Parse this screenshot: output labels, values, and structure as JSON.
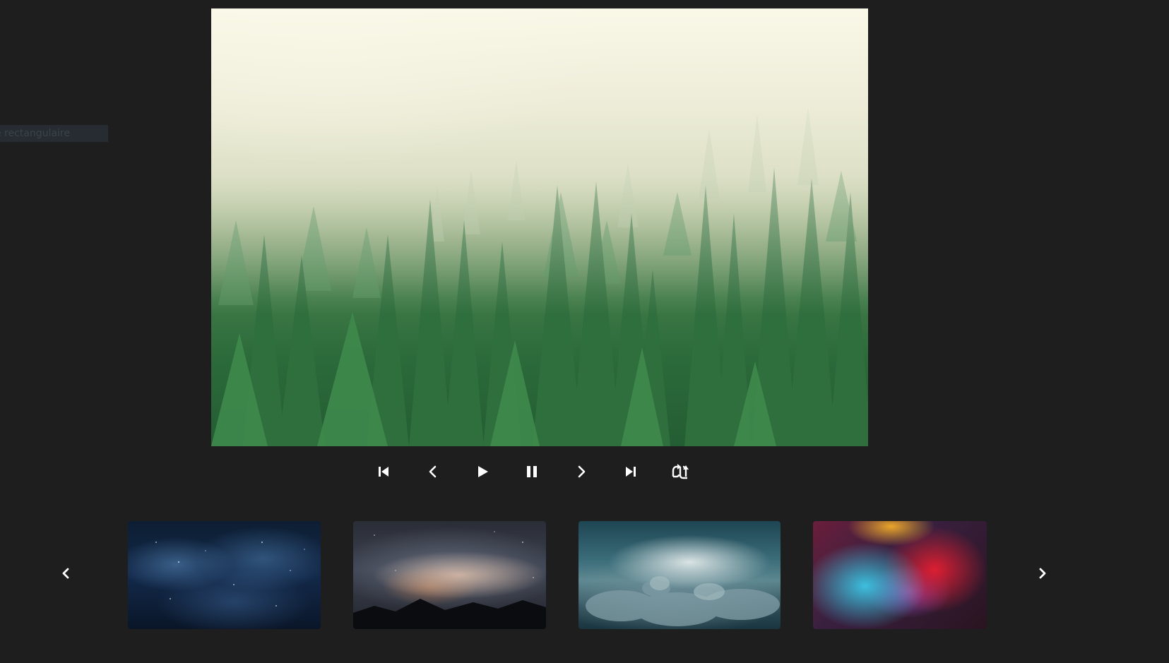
{
  "side_label": {
    "text": "e rectangulaire"
  },
  "viewer": {
    "main_image": {
      "subject": "misty-pine-forest"
    }
  },
  "controls": {
    "icons": [
      "first-icon",
      "previous-icon",
      "play-icon",
      "pause-icon",
      "next-icon",
      "last-icon",
      "shuffle-icon"
    ],
    "icon_color": "#ffffff"
  },
  "thumbnails": {
    "items": [
      {
        "subject": "blue-starfield"
      },
      {
        "subject": "milky-way-over-mountains"
      },
      {
        "subject": "stormy-clouds"
      },
      {
        "subject": "colorful-smoke"
      }
    ]
  },
  "colors": {
    "background": "#1e1e1e",
    "side_label_background": "#262c31",
    "side_label_text": "#3b444c"
  }
}
